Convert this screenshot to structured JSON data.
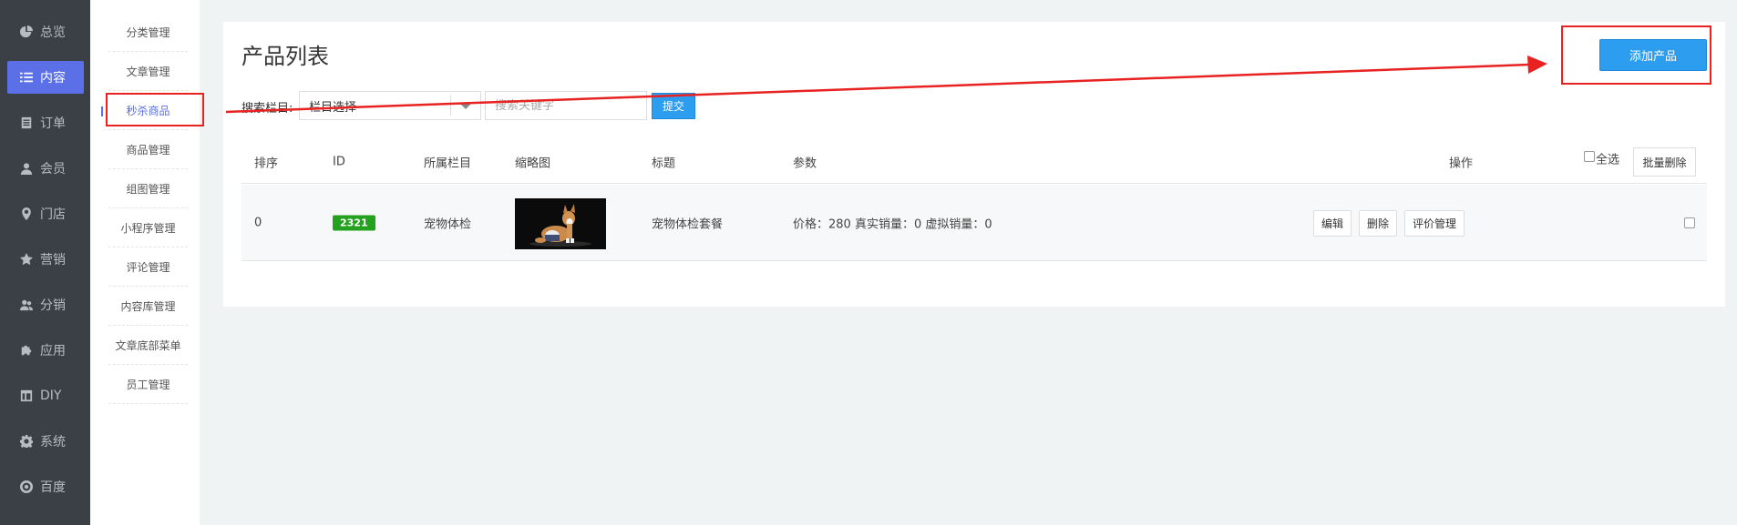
{
  "sidebar": {
    "items": [
      {
        "label": "总览",
        "icon": "pie-chart-icon"
      },
      {
        "label": "内容",
        "icon": "list-icon",
        "active": true
      },
      {
        "label": "订单",
        "icon": "document-icon"
      },
      {
        "label": "会员",
        "icon": "user-icon"
      },
      {
        "label": "门店",
        "icon": "location-pin-icon"
      },
      {
        "label": "营销",
        "icon": "star-icon"
      },
      {
        "label": "分销",
        "icon": "users-icon"
      },
      {
        "label": "应用",
        "icon": "puzzle-icon"
      },
      {
        "label": "DIY",
        "icon": "layout-icon"
      },
      {
        "label": "系统",
        "icon": "gear-icon"
      },
      {
        "label": "百度",
        "icon": "circle-logo-icon"
      }
    ]
  },
  "subnav": {
    "items": [
      {
        "label": "分类管理"
      },
      {
        "label": "文章管理"
      },
      {
        "label": "秒杀商品",
        "active": true
      },
      {
        "label": "商品管理"
      },
      {
        "label": "组图管理"
      },
      {
        "label": "小程序管理"
      },
      {
        "label": "评论管理"
      },
      {
        "label": "内容库管理"
      },
      {
        "label": "文章底部菜单"
      },
      {
        "label": "员工管理"
      }
    ]
  },
  "main": {
    "title": "产品列表",
    "add_button": "添加产品",
    "search": {
      "label": "搜索栏目:",
      "select_value": "栏目选择",
      "keyword_placeholder": "搜索关键字",
      "submit": "提交"
    },
    "table": {
      "headers": {
        "sort": "排序",
        "id": "ID",
        "category": "所属栏目",
        "thumbnail": "缩略图",
        "title": "标题",
        "params": "参数",
        "actions": "操作",
        "select_all": "全选",
        "bulk_delete": "批量删除"
      },
      "rows": [
        {
          "sort": "0",
          "id": "2321",
          "category": "宠物体检",
          "title": "宠物体检套餐",
          "params": "价格：280 真实销量：0 虚拟销量：0",
          "actions": {
            "edit": "编辑",
            "delete": "删除",
            "reviews": "评价管理"
          }
        }
      ]
    }
  },
  "colors": {
    "accent": "#5b6fe6",
    "primary_button": "#2d9df0",
    "id_badge": "#24a11f",
    "annotation": "#e82121"
  }
}
